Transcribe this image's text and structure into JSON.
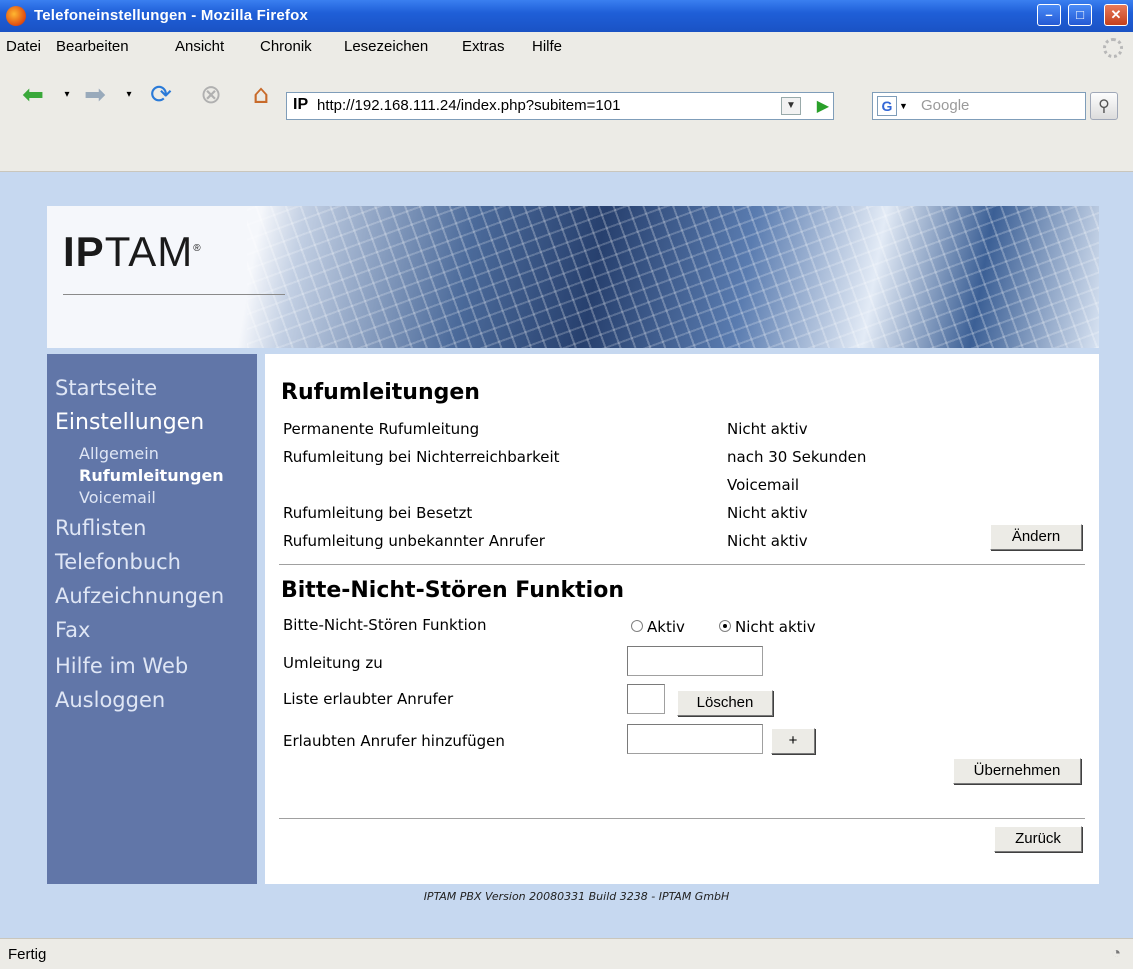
{
  "window": {
    "title": "Telefoneinstellungen - Mozilla Firefox",
    "minimize": "–",
    "maximize": "□",
    "close": "✕"
  },
  "menu": [
    "Datei",
    "Bearbeiten",
    "Ansicht",
    "Chronik",
    "Lesezeichen",
    "Extras",
    "Hilfe"
  ],
  "toolbar": {
    "url": "http://192.168.111.24/index.php?subitem=101",
    "url_favicon": "IP",
    "search_placeholder": "Google",
    "search_engine_icon": "G",
    "icons": [
      "back-arrow-icon",
      "forward-arrow-icon",
      "reload-icon",
      "stop-icon",
      "home-icon",
      "search-icon",
      "go-arrow-icon"
    ]
  },
  "brand": {
    "logo_bold": "IP",
    "logo_rest": "TAM",
    "logo_mark": "®"
  },
  "sidebar": {
    "items": [
      {
        "label": "Startseite",
        "active": false
      },
      {
        "label": "Einstellungen",
        "active": true
      },
      {
        "label": "Allgemein",
        "sub": true,
        "active": false
      },
      {
        "label": "Rufumleitungen",
        "sub": true,
        "active": true
      },
      {
        "label": "Voicemail",
        "sub": true,
        "active": false
      },
      {
        "label": "Ruflisten",
        "active": false
      },
      {
        "label": "Telefonbuch",
        "active": false
      },
      {
        "label": "Aufzeichnungen",
        "active": false
      },
      {
        "label": "Fax",
        "active": false
      },
      {
        "label": "Hilfe im Web",
        "active": false
      },
      {
        "label": "Ausloggen",
        "active": false
      }
    ]
  },
  "forwarding": {
    "heading": "Rufumleitungen",
    "rows": [
      {
        "label": "Permanente Rufumleitung",
        "value": "Nicht aktiv"
      },
      {
        "label": "Rufumleitung bei Nichterreichbarkeit",
        "value": "nach 30 Sekunden"
      },
      {
        "label": "",
        "value": "Voicemail"
      },
      {
        "label": "Rufumleitung bei Besetzt",
        "value": "Nicht aktiv"
      },
      {
        "label": "Rufumleitung unbekannter Anrufer",
        "value": "Nicht aktiv"
      }
    ],
    "change_button": "Ändern"
  },
  "dnd": {
    "heading": "Bitte-Nicht-Stören Funktion",
    "function_label": "Bitte-Nicht-Stören Funktion",
    "option_active": "Aktiv",
    "option_inactive": "Nicht aktiv",
    "selected": "Nicht aktiv",
    "redirect_label": "Umleitung zu",
    "redirect_value": "",
    "allowed_label": "Liste erlaubter Anrufer",
    "delete_button": "Löschen",
    "add_label": "Erlaubten Anrufer hinzufügen",
    "add_value": "",
    "add_button": "+",
    "apply_button": "Übernehmen"
  },
  "back_button": "Zurück",
  "footer": "IPTAM PBX Version 20080331 Build 3238 - IPTAM GmbH",
  "status": "Fertig"
}
